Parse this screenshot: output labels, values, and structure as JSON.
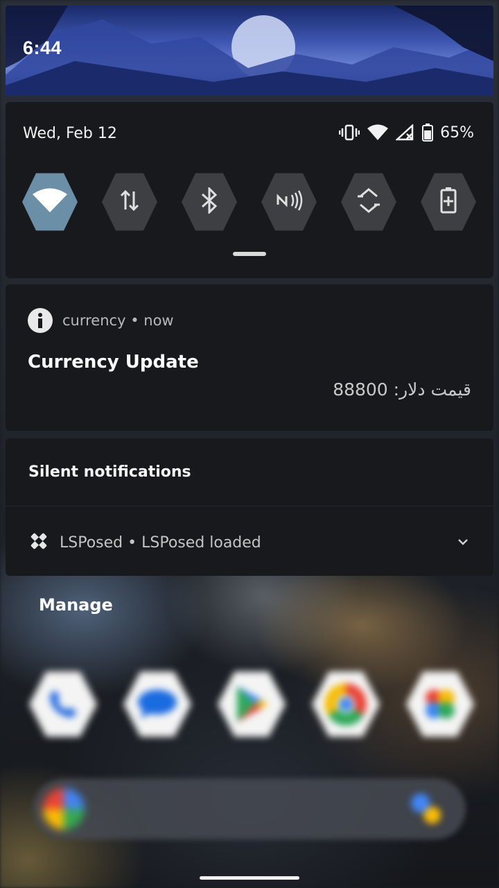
{
  "status": {
    "time": "6:44",
    "date": "Wed, Feb 12",
    "battery_percent": "65%"
  },
  "quick_settings": {
    "tiles": [
      {
        "name": "wifi-icon",
        "active": true
      },
      {
        "name": "mobile-data-icon",
        "active": false
      },
      {
        "name": "bluetooth-icon",
        "active": false
      },
      {
        "name": "nfc-icon",
        "active": false
      },
      {
        "name": "auto-rotate-icon",
        "active": false
      },
      {
        "name": "battery-saver-icon",
        "active": false
      }
    ]
  },
  "notifications": {
    "currency": {
      "app": "currency",
      "separator": "•",
      "time": "now",
      "title": "Currency Update",
      "body": "قیمت دلار: 88800"
    },
    "silent": {
      "section_title": "Silent notifications",
      "app": "LSPosed",
      "separator": "•",
      "text": "LSPosed loaded"
    }
  },
  "manage_label": "Manage",
  "dock": {
    "apps": [
      "phone-icon",
      "messages-icon",
      "play-store-icon",
      "chrome-icon",
      "photos-icon"
    ]
  },
  "colors": {
    "panel_bg": "#17191d",
    "active_tile": "#6b8fa6",
    "inactive_tile": "#3d3f43"
  }
}
